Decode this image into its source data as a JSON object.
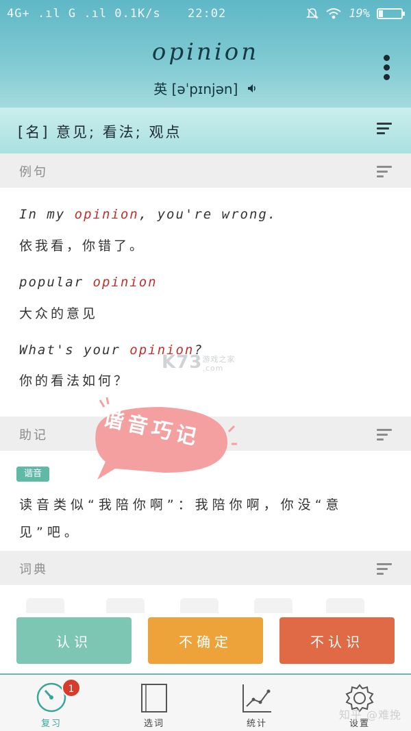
{
  "status_bar": {
    "network": "4G+ .ıl G .ıl 0.1K/s",
    "time": "22:02",
    "battery": "19%",
    "battery_level": 0.19
  },
  "word": {
    "headword": "opinion",
    "phonetic_region": "英",
    "phonetic": "[əˈpɪnjən]"
  },
  "meaning": "[名] 意见; 看法; 观点",
  "sections": {
    "examples_label": "例句",
    "mnemonic_label": "助记",
    "dictionary_label": "词典"
  },
  "examples": [
    {
      "en_before": "In my ",
      "en_hl": "opinion",
      "en_after": ", you're wrong.",
      "zh": "依我看，你错了。"
    },
    {
      "en_before": "popular ",
      "en_hl": "opinion",
      "en_after": "",
      "zh": "大众的意见"
    },
    {
      "en_before": "What's your ",
      "en_hl": "opinion",
      "en_after": "?",
      "zh": "你的看法如何？"
    }
  ],
  "watermark": {
    "brand": "K73",
    "sub1": "游戏之家",
    "sub2": ".com"
  },
  "sticker_text": "谐音巧记",
  "mnemonic": {
    "tag": "谐音",
    "text": "读音类似“我陪你啊”：我陪你啊，你没“意见”吧。"
  },
  "actions": {
    "know": "认识",
    "unsure": "不确定",
    "dont_know": "不认识"
  },
  "tabs": [
    {
      "label": "复习",
      "icon": "dial-icon",
      "active": true,
      "badge": "1"
    },
    {
      "label": "选词",
      "icon": "book-icon",
      "active": false
    },
    {
      "label": "统计",
      "icon": "chart-icon",
      "active": false
    },
    {
      "label": "设置",
      "icon": "gear-icon",
      "active": false
    }
  ],
  "overlay_watermark": "知乎 @难挽",
  "colors": {
    "header_top": "#5fb7c6",
    "meaning_bg": "#b8e6e4",
    "highlight": "#c0302c",
    "tag_green": "#5fb9a6",
    "btn_know": "#7cc6b3",
    "btn_unsure": "#eda23a",
    "btn_dont_know": "#e06a45",
    "tab_active": "#3aa59a",
    "badge": "#d83a2c",
    "sticker": "#f4a0a0"
  }
}
